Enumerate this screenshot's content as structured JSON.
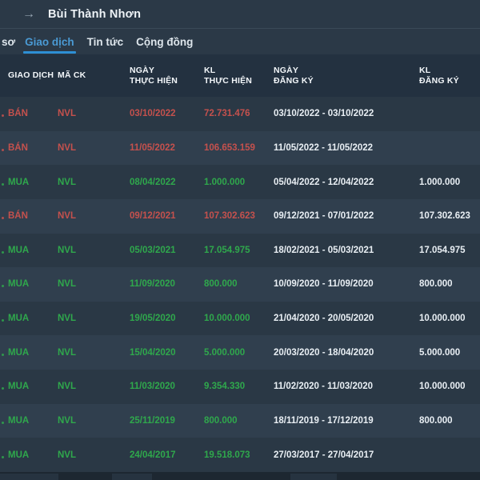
{
  "header": {
    "back_arrow": "→",
    "title": "Bùi Thành Nhơn"
  },
  "tabs": [
    {
      "label": "sơ",
      "active": false
    },
    {
      "label": "Giao dịch",
      "active": true
    },
    {
      "label": "Tin tức",
      "active": false
    },
    {
      "label": "Cộng đồng",
      "active": false
    }
  ],
  "table": {
    "columns": [
      {
        "line1": "GIAO DỊCH",
        "line2": ""
      },
      {
        "line1": "MÃ CK",
        "line2": ""
      },
      {
        "line1": "NGÀY",
        "line2": "THỰC HIỆN"
      },
      {
        "line1": "KL",
        "line2": "THỰC HIỆN"
      },
      {
        "line1": "NGÀY",
        "line2": "ĐĂNG KÝ"
      },
      {
        "line1": "KL",
        "line2": "ĐĂNG KÝ"
      }
    ],
    "rows": [
      {
        "action": "BÁN",
        "type": "sell",
        "ticker": "NVL",
        "exec_date": "03/10/2022",
        "exec_vol": "72.731.476",
        "reg_period": "03/10/2022 - 03/10/2022",
        "reg_vol": ""
      },
      {
        "action": "BÁN",
        "type": "sell",
        "ticker": "NVL",
        "exec_date": "11/05/2022",
        "exec_vol": "106.653.159",
        "reg_period": "11/05/2022 - 11/05/2022",
        "reg_vol": ""
      },
      {
        "action": "MUA",
        "type": "buy",
        "ticker": "NVL",
        "exec_date": "08/04/2022",
        "exec_vol": "1.000.000",
        "reg_period": "05/04/2022 - 12/04/2022",
        "reg_vol": "1.000.000"
      },
      {
        "action": "BÁN",
        "type": "sell",
        "ticker": "NVL",
        "exec_date": "09/12/2021",
        "exec_vol": "107.302.623",
        "reg_period": "09/12/2021 - 07/01/2022",
        "reg_vol": "107.302.623"
      },
      {
        "action": "MUA",
        "type": "buy",
        "ticker": "NVL",
        "exec_date": "05/03/2021",
        "exec_vol": "17.054.975",
        "reg_period": "18/02/2021 - 05/03/2021",
        "reg_vol": "17.054.975"
      },
      {
        "action": "MUA",
        "type": "buy",
        "ticker": "NVL",
        "exec_date": "11/09/2020",
        "exec_vol": "800.000",
        "reg_period": "10/09/2020 - 11/09/2020",
        "reg_vol": "800.000"
      },
      {
        "action": "MUA",
        "type": "buy",
        "ticker": "NVL",
        "exec_date": "19/05/2020",
        "exec_vol": "10.000.000",
        "reg_period": "21/04/2020 - 20/05/2020",
        "reg_vol": "10.000.000"
      },
      {
        "action": "MUA",
        "type": "buy",
        "ticker": "NVL",
        "exec_date": "15/04/2020",
        "exec_vol": "5.000.000",
        "reg_period": "20/03/2020 - 18/04/2020",
        "reg_vol": "5.000.000"
      },
      {
        "action": "MUA",
        "type": "buy",
        "ticker": "NVL",
        "exec_date": "11/03/2020",
        "exec_vol": "9.354.330",
        "reg_period": "11/02/2020 - 11/03/2020",
        "reg_vol": "10.000.000"
      },
      {
        "action": "MUA",
        "type": "buy",
        "ticker": "NVL",
        "exec_date": "25/11/2019",
        "exec_vol": "800.000",
        "reg_period": "18/11/2019 - 17/12/2019",
        "reg_vol": "800.000"
      },
      {
        "action": "MUA",
        "type": "buy",
        "ticker": "NVL",
        "exec_date": "24/04/2017",
        "exec_vol": "19.518.073",
        "reg_period": "27/03/2017 - 27/04/2017",
        "reg_vol": ""
      }
    ]
  },
  "colors": {
    "accent_blue": "#4A9AD4",
    "tab_underline": "#2E8FD4",
    "sell_red": "#C5514D",
    "buy_green": "#2FA84C",
    "text_white": "#E9EFF4",
    "header_bg": "#233140",
    "row_odd_bg": "#2A3845",
    "row_even_bg": "#303F4E"
  }
}
